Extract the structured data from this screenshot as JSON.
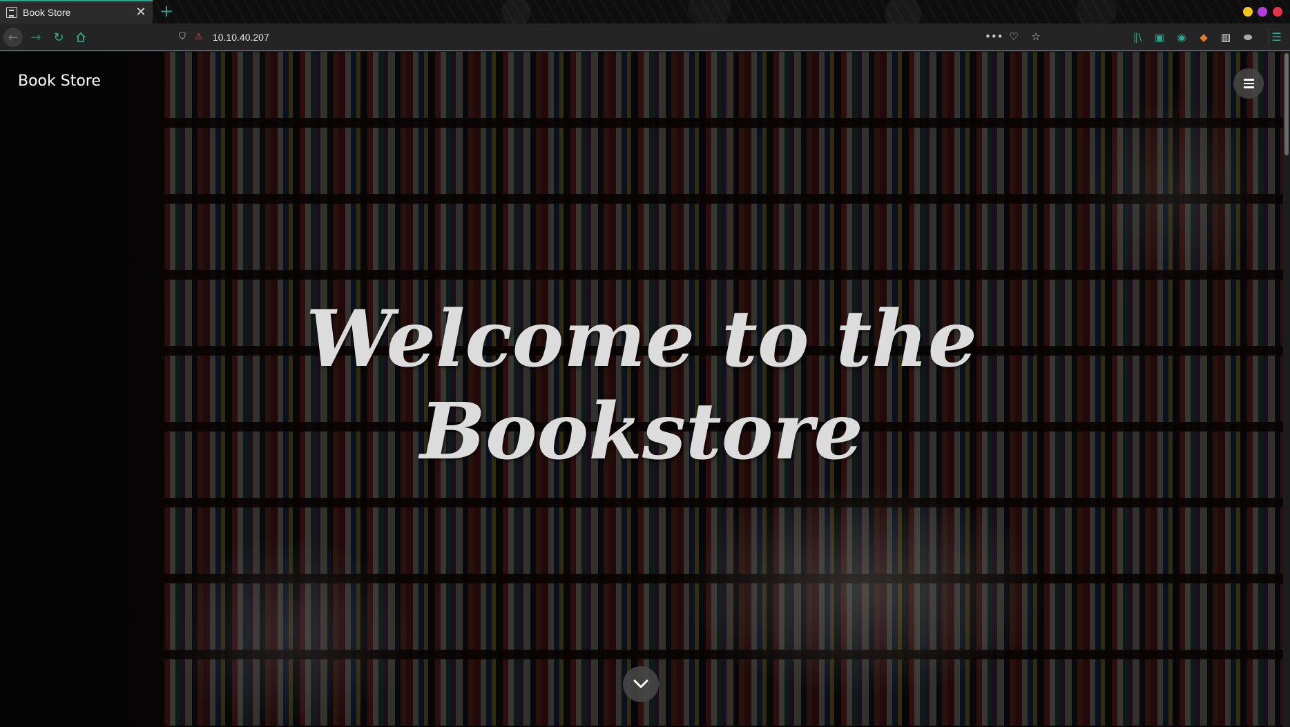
{
  "browser": {
    "tab_title": "Book Store",
    "tab_close": "✕",
    "new_tab": "+",
    "url": "10.10.40.207",
    "window_controls": {
      "minimize_color": "#f5c518",
      "maximize_color": "#b43cdc",
      "close_color": "#e6334a"
    },
    "accent_color": "#2ea78c"
  },
  "page": {
    "brand": "Book Store",
    "headline_line1": "Welcome to the",
    "headline_line2": "Bookstore"
  }
}
